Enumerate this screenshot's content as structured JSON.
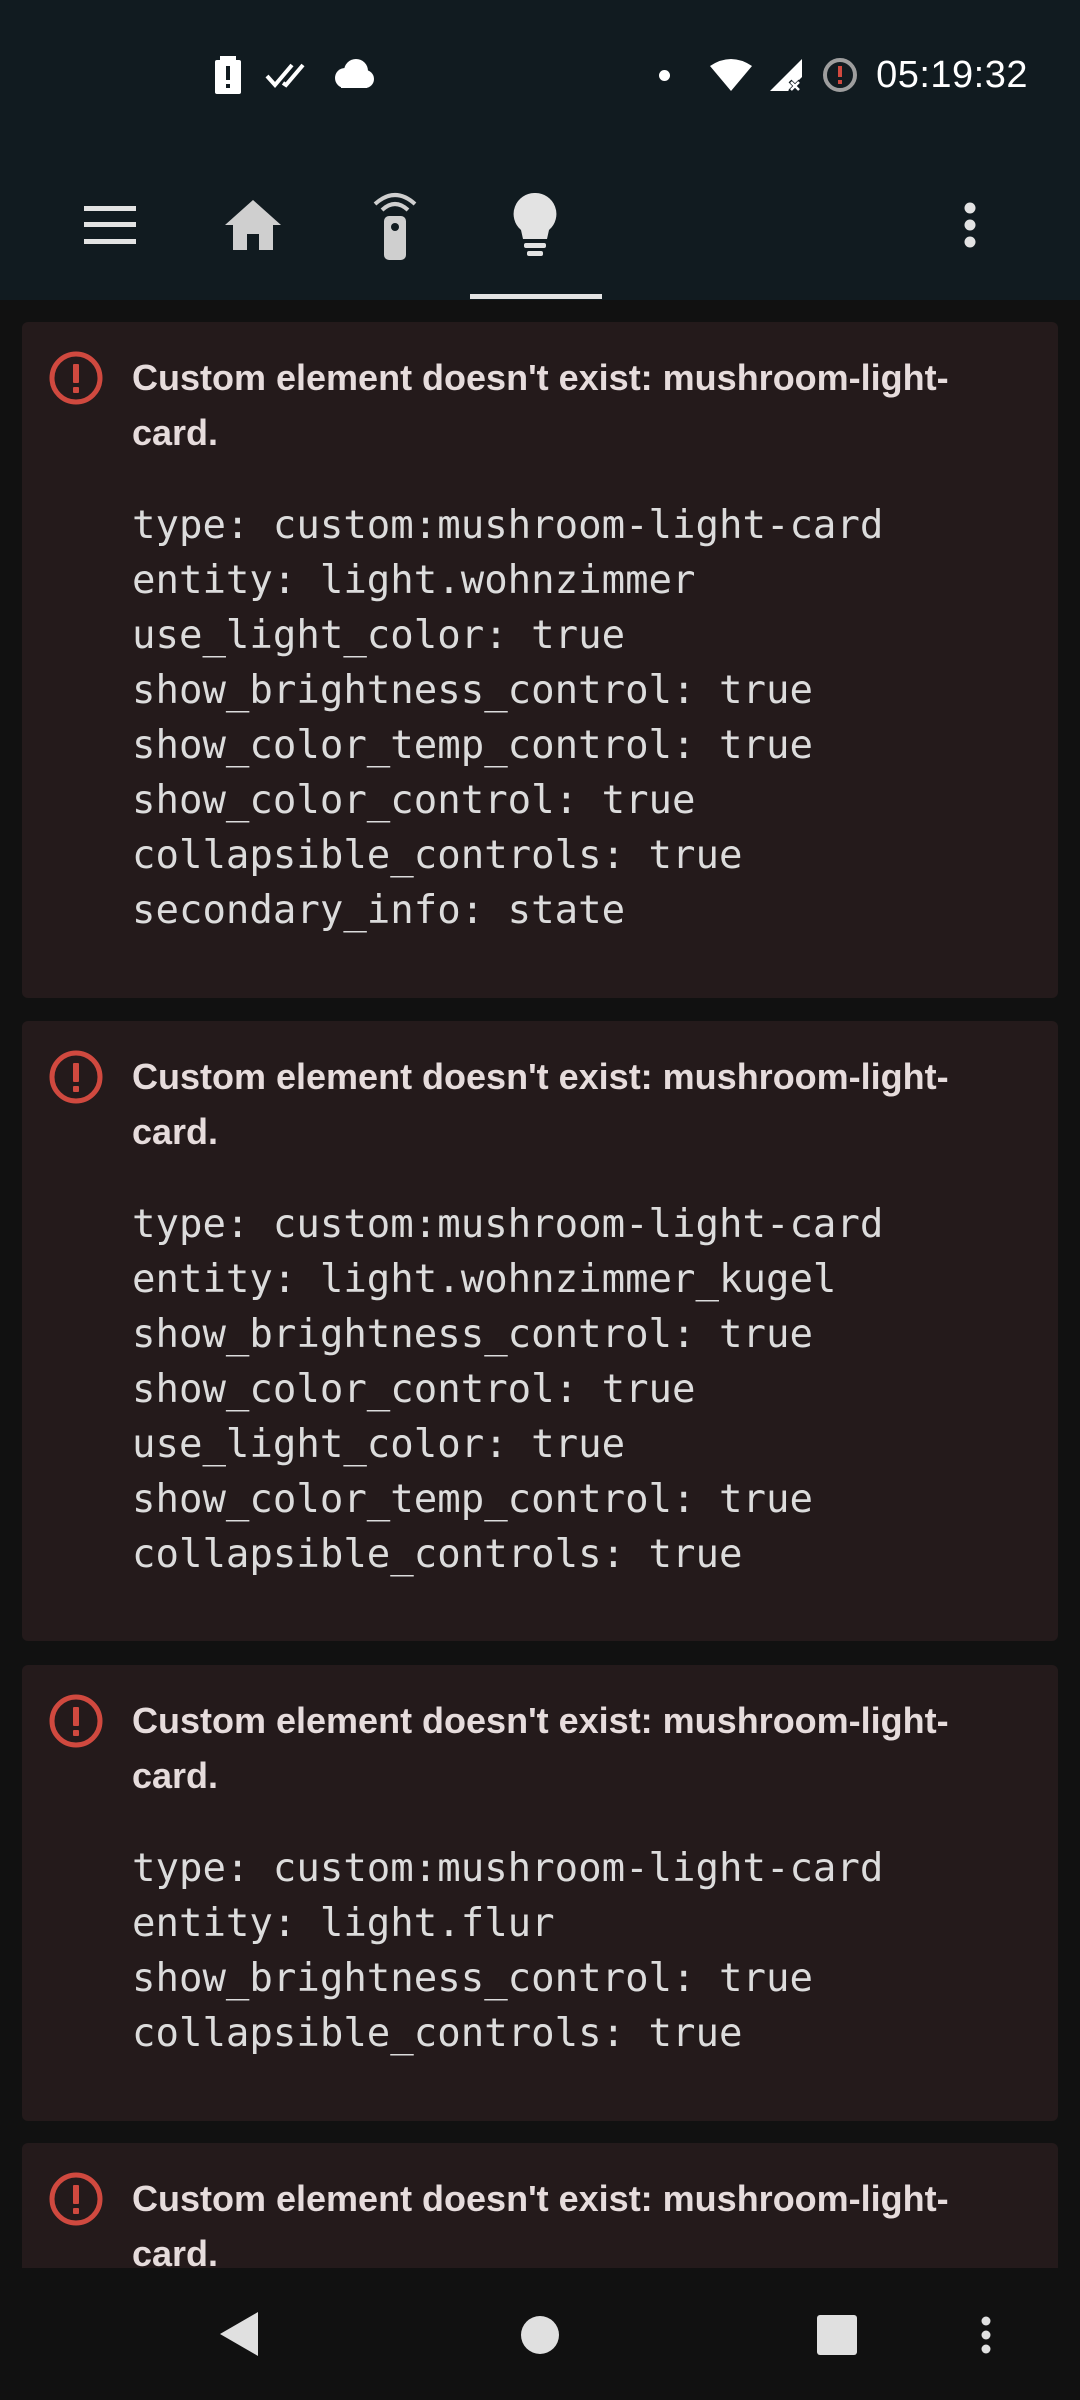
{
  "status_bar": {
    "time": "05:19:32",
    "left_icons": [
      "battery-alert-icon",
      "double-check-icon",
      "cloud-icon"
    ],
    "right_icons": [
      "notification-dot-icon",
      "wifi-icon",
      "signal-off-icon",
      "alarm-alert-icon"
    ]
  },
  "toolbar": {
    "icons": [
      "menu-icon",
      "home-icon",
      "remote-icon",
      "lightbulb-icon",
      "more-vert-icon"
    ],
    "active_tab": "lightbulb-icon"
  },
  "cards": [
    {
      "title": "Custom element doesn't exist: mushroom-light-card.",
      "lines": [
        "type: custom:mushroom-light-card",
        "entity: light.wohnzimmer",
        "use_light_color: true",
        "show_brightness_control: true",
        "show_color_temp_control: true",
        "show_color_control: true",
        "collapsible_controls: true",
        "secondary_info: state"
      ]
    },
    {
      "title": "Custom element doesn't exist: mushroom-light-card.",
      "lines": [
        "type: custom:mushroom-light-card",
        "entity: light.wohnzimmer_kugel",
        "show_brightness_control: true",
        "show_color_control: true",
        "use_light_color: true",
        "show_color_temp_control: true",
        "collapsible_controls: true"
      ]
    },
    {
      "title": "Custom element doesn't exist: mushroom-light-card.",
      "lines": [
        "type: custom:mushroom-light-card",
        "entity: light.flur",
        "show_brightness_control: true",
        "collapsible_controls: true"
      ]
    },
    {
      "title": "Custom element doesn't exist: mushroom-light-card.",
      "lines": []
    }
  ],
  "nav_bar": {
    "icons": [
      "back-icon",
      "home-circle-icon",
      "recents-icon",
      "more-vert-icon"
    ]
  },
  "colors": {
    "bar_bg": "#111b20",
    "card_bg": "#241a1b",
    "error_red": "#d0493f",
    "title_text": "#e6dcdc",
    "code_text": "#dcdcdc"
  }
}
